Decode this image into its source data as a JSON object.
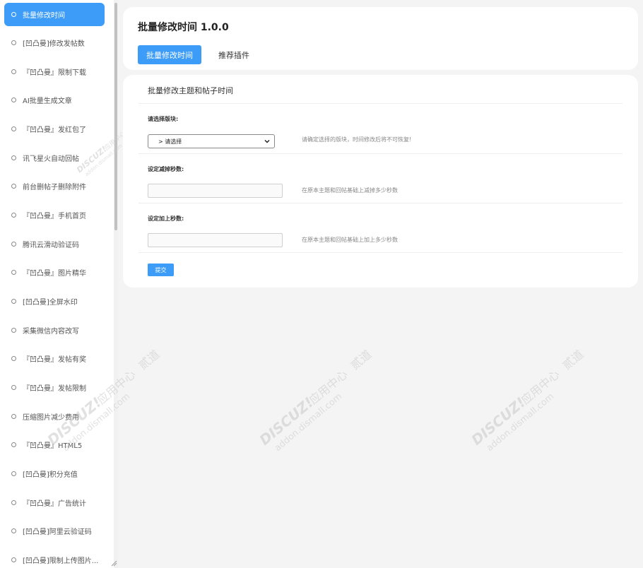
{
  "sidebar": {
    "items": [
      {
        "label": "批量修改时间",
        "active": true
      },
      {
        "label": "[凹凸曼]修改发帖数"
      },
      {
        "label": "『凹凸曼』限制下载"
      },
      {
        "label": "AI批量生成文章"
      },
      {
        "label": "『凹凸曼』发红包了"
      },
      {
        "label": "讯飞星火自动回帖"
      },
      {
        "label": "前台删帖子删除附件"
      },
      {
        "label": "『凹凸曼』手机首页"
      },
      {
        "label": "腾讯云滑动验证码"
      },
      {
        "label": "『凹凸曼』图片精华"
      },
      {
        "label": "[凹凸曼]全屏水印"
      },
      {
        "label": "采集微信内容改写"
      },
      {
        "label": "『凹凸曼』发帖有奖"
      },
      {
        "label": "『凹凸曼』发帖限制"
      },
      {
        "label": "压缩图片减少费用"
      },
      {
        "label": "『凹凸曼』HTML5"
      },
      {
        "label": "[凹凸曼]积分充值"
      },
      {
        "label": "『凹凸曼』广告统计"
      },
      {
        "label": "[凹凸曼]阿里云验证码"
      },
      {
        "label": "[凹凸曼]限制上传图片..."
      }
    ]
  },
  "header": {
    "title": "批量修改时间 1.0.0",
    "tabs": [
      {
        "label": "批量修改时间",
        "active": true
      },
      {
        "label": "推荐插件"
      }
    ]
  },
  "form": {
    "section_title": "批量修改主题和帖子时间",
    "forum_label": "请选择版块:",
    "forum_select_value": "> 请选择",
    "forum_hint": "请确定选择的版块，时间修改后将不可恢复!",
    "subtract_label": "设定减掉秒数:",
    "subtract_value": "",
    "subtract_hint": "在原本主题和回帖基础上减掉多少秒数",
    "add_label": "设定加上秒数:",
    "add_value": "",
    "add_hint": "在原本主题和回帖基础上加上多少秒数",
    "submit_label": "提交"
  },
  "watermark": {
    "brand": "DISCUZ!",
    "center": "应用中心",
    "right": "贰道",
    "url": "addon.dismall.com"
  },
  "colors": {
    "accent": "#3c9cf7",
    "background": "#f4f4f4",
    "panel": "#ffffff"
  }
}
